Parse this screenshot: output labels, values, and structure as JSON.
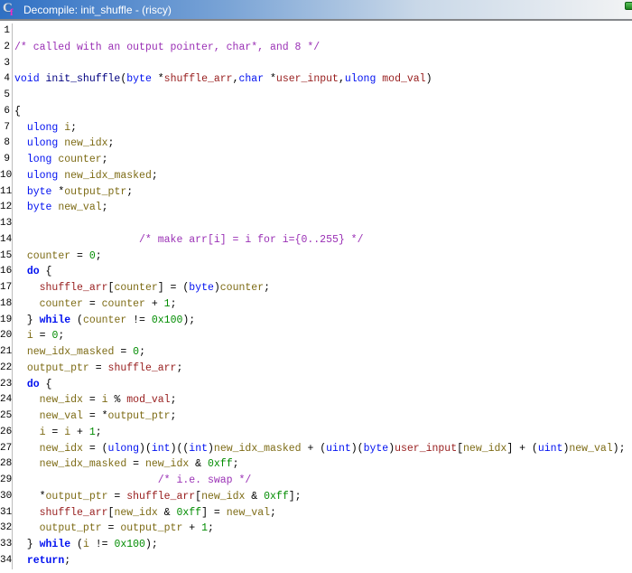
{
  "window": {
    "title": "Decompile: init_shuffle - (riscy)",
    "icon_letter": "C",
    "icon_sub": "f"
  },
  "icons": {
    "decompiler_icon": "C-with-pink-f",
    "truncated_toolbar_icon": "green-square-fragment"
  },
  "palette": {
    "kw": "#0010f0",
    "ty": "#0010f0",
    "fn": "#000080",
    "lv": "#7d6b15",
    "pm": "#971c1c",
    "ct": "#008c00",
    "cm": "#9a30b5",
    "df": "#000000",
    "ttl": "#ffffff",
    "gl": "#bcbcbc",
    "tb1": "#2f70c4",
    "tb2": "#7aa4d6",
    "tb3": "#c9d8e8",
    "tb4": "#f2f3f4"
  },
  "token_legend": {
    "k": "keyword",
    "t": "data-type",
    "f": "function-name",
    "v": "local-variable",
    "p": "parameter",
    "c": "constant",
    "m": "comment",
    "d": "plain"
  },
  "editor": {
    "lines": [
      {
        "n": "1",
        "t": []
      },
      {
        "n": "2",
        "t": [
          [
            "m",
            "/* called with an output pointer, char*, and 8 */"
          ]
        ]
      },
      {
        "n": "3",
        "t": []
      },
      {
        "n": "4",
        "t": [
          [
            "t",
            "void"
          ],
          [
            "d",
            " "
          ],
          [
            "f",
            "init_shuffle"
          ],
          [
            "d",
            "("
          ],
          [
            "t",
            "byte"
          ],
          [
            "d",
            " *"
          ],
          [
            "p",
            "shuffle_arr"
          ],
          [
            "d",
            ","
          ],
          [
            "t",
            "char"
          ],
          [
            "d",
            " *"
          ],
          [
            "p",
            "user_input"
          ],
          [
            "d",
            ","
          ],
          [
            "t",
            "ulong"
          ],
          [
            "d",
            " "
          ],
          [
            "p",
            "mod_val"
          ],
          [
            "d",
            ")"
          ]
        ]
      },
      {
        "n": "5",
        "t": []
      },
      {
        "n": "6",
        "t": [
          [
            "d",
            "{"
          ]
        ]
      },
      {
        "n": "7",
        "t": [
          [
            "d",
            "  "
          ],
          [
            "t",
            "ulong"
          ],
          [
            "d",
            " "
          ],
          [
            "v",
            "i"
          ],
          [
            "d",
            ";"
          ]
        ]
      },
      {
        "n": "8",
        "t": [
          [
            "d",
            "  "
          ],
          [
            "t",
            "ulong"
          ],
          [
            "d",
            " "
          ],
          [
            "v",
            "new_idx"
          ],
          [
            "d",
            ";"
          ]
        ]
      },
      {
        "n": "9",
        "t": [
          [
            "d",
            "  "
          ],
          [
            "t",
            "long"
          ],
          [
            "d",
            " "
          ],
          [
            "v",
            "counter"
          ],
          [
            "d",
            ";"
          ]
        ]
      },
      {
        "n": "10",
        "t": [
          [
            "d",
            "  "
          ],
          [
            "t",
            "ulong"
          ],
          [
            "d",
            " "
          ],
          [
            "v",
            "new_idx_masked"
          ],
          [
            "d",
            ";"
          ]
        ]
      },
      {
        "n": "11",
        "t": [
          [
            "d",
            "  "
          ],
          [
            "t",
            "byte"
          ],
          [
            "d",
            " *"
          ],
          [
            "v",
            "output_ptr"
          ],
          [
            "d",
            ";"
          ]
        ]
      },
      {
        "n": "12",
        "t": [
          [
            "d",
            "  "
          ],
          [
            "t",
            "byte"
          ],
          [
            "d",
            " "
          ],
          [
            "v",
            "new_val"
          ],
          [
            "d",
            ";"
          ]
        ]
      },
      {
        "n": "13",
        "t": []
      },
      {
        "n": "14",
        "t": [
          [
            "d",
            "                    "
          ],
          [
            "m",
            "/* make arr[i] = i for i={0..255} */"
          ]
        ]
      },
      {
        "n": "15",
        "t": [
          [
            "d",
            "  "
          ],
          [
            "v",
            "counter"
          ],
          [
            "d",
            " = "
          ],
          [
            "c",
            "0"
          ],
          [
            "d",
            ";"
          ]
        ]
      },
      {
        "n": "16",
        "t": [
          [
            "d",
            "  "
          ],
          [
            "k",
            "do"
          ],
          [
            "d",
            " {"
          ]
        ]
      },
      {
        "n": "17",
        "t": [
          [
            "d",
            "    "
          ],
          [
            "p",
            "shuffle_arr"
          ],
          [
            "d",
            "["
          ],
          [
            "v",
            "counter"
          ],
          [
            "d",
            "] = ("
          ],
          [
            "t",
            "byte"
          ],
          [
            "d",
            ")"
          ],
          [
            "v",
            "counter"
          ],
          [
            "d",
            ";"
          ]
        ]
      },
      {
        "n": "18",
        "t": [
          [
            "d",
            "    "
          ],
          [
            "v",
            "counter"
          ],
          [
            "d",
            " = "
          ],
          [
            "v",
            "counter"
          ],
          [
            "d",
            " + "
          ],
          [
            "c",
            "1"
          ],
          [
            "d",
            ";"
          ]
        ]
      },
      {
        "n": "19",
        "t": [
          [
            "d",
            "  } "
          ],
          [
            "k",
            "while"
          ],
          [
            "d",
            " ("
          ],
          [
            "v",
            "counter"
          ],
          [
            "d",
            " != "
          ],
          [
            "c",
            "0x100"
          ],
          [
            "d",
            ");"
          ]
        ]
      },
      {
        "n": "20",
        "t": [
          [
            "d",
            "  "
          ],
          [
            "v",
            "i"
          ],
          [
            "d",
            " = "
          ],
          [
            "c",
            "0"
          ],
          [
            "d",
            ";"
          ]
        ]
      },
      {
        "n": "21",
        "t": [
          [
            "d",
            "  "
          ],
          [
            "v",
            "new_idx_masked"
          ],
          [
            "d",
            " = "
          ],
          [
            "c",
            "0"
          ],
          [
            "d",
            ";"
          ]
        ]
      },
      {
        "n": "22",
        "t": [
          [
            "d",
            "  "
          ],
          [
            "v",
            "output_ptr"
          ],
          [
            "d",
            " = "
          ],
          [
            "p",
            "shuffle_arr"
          ],
          [
            "d",
            ";"
          ]
        ]
      },
      {
        "n": "23",
        "t": [
          [
            "d",
            "  "
          ],
          [
            "k",
            "do"
          ],
          [
            "d",
            " {"
          ]
        ]
      },
      {
        "n": "24",
        "t": [
          [
            "d",
            "    "
          ],
          [
            "v",
            "new_idx"
          ],
          [
            "d",
            " = "
          ],
          [
            "v",
            "i"
          ],
          [
            "d",
            " % "
          ],
          [
            "p",
            "mod_val"
          ],
          [
            "d",
            ";"
          ]
        ]
      },
      {
        "n": "25",
        "t": [
          [
            "d",
            "    "
          ],
          [
            "v",
            "new_val"
          ],
          [
            "d",
            " = *"
          ],
          [
            "v",
            "output_ptr"
          ],
          [
            "d",
            ";"
          ]
        ]
      },
      {
        "n": "26",
        "t": [
          [
            "d",
            "    "
          ],
          [
            "v",
            "i"
          ],
          [
            "d",
            " = "
          ],
          [
            "v",
            "i"
          ],
          [
            "d",
            " + "
          ],
          [
            "c",
            "1"
          ],
          [
            "d",
            ";"
          ]
        ]
      },
      {
        "n": "27",
        "t": [
          [
            "d",
            "    "
          ],
          [
            "v",
            "new_idx"
          ],
          [
            "d",
            " = ("
          ],
          [
            "t",
            "ulong"
          ],
          [
            "d",
            ")("
          ],
          [
            "t",
            "int"
          ],
          [
            "d",
            ")(("
          ],
          [
            "t",
            "int"
          ],
          [
            "d",
            ")"
          ],
          [
            "v",
            "new_idx_masked"
          ],
          [
            "d",
            " + ("
          ],
          [
            "t",
            "uint"
          ],
          [
            "d",
            ")("
          ],
          [
            "t",
            "byte"
          ],
          [
            "d",
            ")"
          ],
          [
            "p",
            "user_input"
          ],
          [
            "d",
            "["
          ],
          [
            "v",
            "new_idx"
          ],
          [
            "d",
            "] + ("
          ],
          [
            "t",
            "uint"
          ],
          [
            "d",
            ")"
          ],
          [
            "v",
            "new_val"
          ],
          [
            "d",
            ");"
          ]
        ]
      },
      {
        "n": "28",
        "t": [
          [
            "d",
            "    "
          ],
          [
            "v",
            "new_idx_masked"
          ],
          [
            "d",
            " = "
          ],
          [
            "v",
            "new_idx"
          ],
          [
            "d",
            " & "
          ],
          [
            "c",
            "0xff"
          ],
          [
            "d",
            ";"
          ]
        ]
      },
      {
        "n": "29",
        "t": [
          [
            "d",
            "                       "
          ],
          [
            "m",
            "/* i.e. swap */"
          ]
        ]
      },
      {
        "n": "30",
        "t": [
          [
            "d",
            "    *"
          ],
          [
            "v",
            "output_ptr"
          ],
          [
            "d",
            " = "
          ],
          [
            "p",
            "shuffle_arr"
          ],
          [
            "d",
            "["
          ],
          [
            "v",
            "new_idx"
          ],
          [
            "d",
            " & "
          ],
          [
            "c",
            "0xff"
          ],
          [
            "d",
            "];"
          ]
        ]
      },
      {
        "n": "31",
        "t": [
          [
            "d",
            "    "
          ],
          [
            "p",
            "shuffle_arr"
          ],
          [
            "d",
            "["
          ],
          [
            "v",
            "new_idx"
          ],
          [
            "d",
            " & "
          ],
          [
            "c",
            "0xff"
          ],
          [
            "d",
            "] = "
          ],
          [
            "v",
            "new_val"
          ],
          [
            "d",
            ";"
          ]
        ]
      },
      {
        "n": "32",
        "t": [
          [
            "d",
            "    "
          ],
          [
            "v",
            "output_ptr"
          ],
          [
            "d",
            " = "
          ],
          [
            "v",
            "output_ptr"
          ],
          [
            "d",
            " + "
          ],
          [
            "c",
            "1"
          ],
          [
            "d",
            ";"
          ]
        ]
      },
      {
        "n": "33",
        "t": [
          [
            "d",
            "  } "
          ],
          [
            "k",
            "while"
          ],
          [
            "d",
            " ("
          ],
          [
            "v",
            "i"
          ],
          [
            "d",
            " != "
          ],
          [
            "c",
            "0x100"
          ],
          [
            "d",
            ");"
          ]
        ]
      },
      {
        "n": "34",
        "t": [
          [
            "d",
            "  "
          ],
          [
            "k",
            "return"
          ],
          [
            "d",
            ";"
          ]
        ]
      }
    ]
  }
}
